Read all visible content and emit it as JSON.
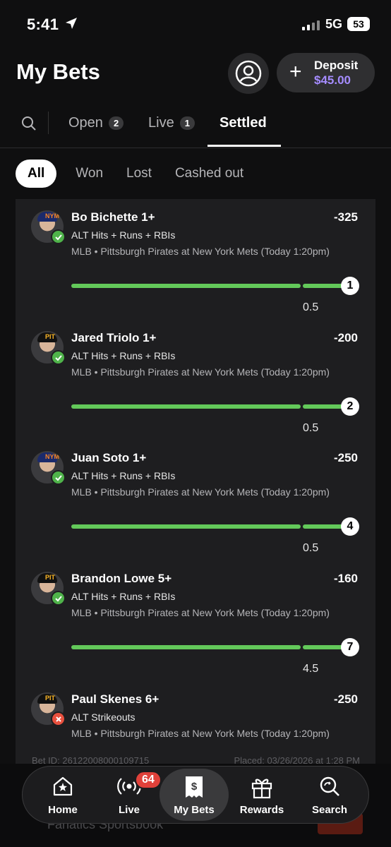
{
  "status_bar": {
    "time": "5:41",
    "network": "5G",
    "battery": "53"
  },
  "header": {
    "title": "My Bets",
    "deposit_label": "Deposit",
    "deposit_amount": "$45.00"
  },
  "tabs": [
    {
      "label": "Open",
      "count": "2"
    },
    {
      "label": "Live",
      "count": "1"
    },
    {
      "label": "Settled",
      "count": null
    }
  ],
  "filters": [
    "All",
    "Won",
    "Lost",
    "Cashed out"
  ],
  "legs": [
    {
      "player": "Bo Bichette 1+",
      "odds": "-325",
      "market": "ALT Hits + Runs + RBIs",
      "event": "MLB • Pittsburgh Pirates at New York Mets (Today 1:20pm)",
      "result": "1",
      "line": "0.5",
      "status": "won",
      "team": "NYM"
    },
    {
      "player": "Jared Triolo 1+",
      "odds": "-200",
      "market": "ALT Hits + Runs + RBIs",
      "event": "MLB • Pittsburgh Pirates at New York Mets (Today 1:20pm)",
      "result": "2",
      "line": "0.5",
      "status": "won",
      "team": "PIT"
    },
    {
      "player": "Juan Soto 1+",
      "odds": "-250",
      "market": "ALT Hits + Runs + RBIs",
      "event": "MLB • Pittsburgh Pirates at New York Mets (Today 1:20pm)",
      "result": "4",
      "line": "0.5",
      "status": "won",
      "team": "NYM"
    },
    {
      "player": "Brandon Lowe 5+",
      "odds": "-160",
      "market": "ALT Hits + Runs + RBIs",
      "event": "MLB • Pittsburgh Pirates at New York Mets (Today 1:20pm)",
      "result": "7",
      "line": "4.5",
      "status": "won",
      "team": "PIT"
    },
    {
      "player": "Paul Skenes 6+",
      "odds": "-250",
      "market": "ALT Strikeouts",
      "event": "MLB • Pittsburgh Pirates at New York Mets (Today 1:20pm)",
      "result": null,
      "line": null,
      "status": "lost",
      "team": "PIT"
    }
  ],
  "bet_meta": {
    "bet_id": "Bet ID: 26122008000109715",
    "placed": "Placed: 03/26/2026 at 1:28 PM"
  },
  "ad": {
    "text": "Fanatics Sportsbook"
  },
  "nav": [
    {
      "label": "Home",
      "icon": "home-star-icon"
    },
    {
      "label": "Live",
      "icon": "live-broadcast-icon",
      "badge": "64"
    },
    {
      "label": "My Bets",
      "icon": "bet-slip-icon"
    },
    {
      "label": "Rewards",
      "icon": "gift-icon"
    },
    {
      "label": "Search",
      "icon": "search-icon"
    }
  ],
  "colors": {
    "accent_purple": "#a58cff",
    "win_green": "#4fb34a",
    "progress_green": "#63c95a",
    "loss_red": "#e8503e",
    "badge_red": "#e0413a"
  }
}
